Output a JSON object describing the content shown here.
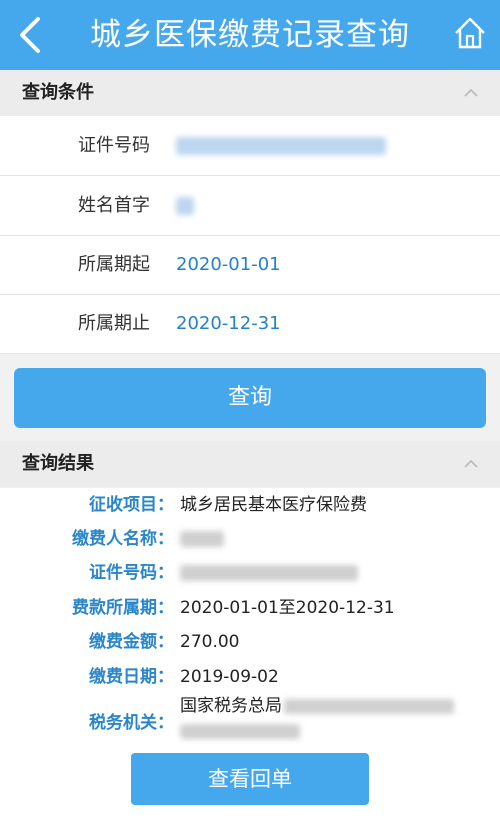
{
  "header": {
    "title": "城乡医保缴费记录查询",
    "back_icon": "chevron-left-icon",
    "home_icon": "home-icon"
  },
  "query_section": {
    "title": "查询条件",
    "fields": [
      {
        "label": "证件号码",
        "value": ""
      },
      {
        "label": "姓名首字",
        "value": ""
      },
      {
        "label": "所属期起",
        "value": "2020-01-01"
      },
      {
        "label": "所属期止",
        "value": "2020-12-31"
      }
    ],
    "submit_label": "查询"
  },
  "result_section": {
    "title": "查询结果",
    "items": [
      {
        "label": "征收项目：",
        "value": "城乡居民基本医疗保险费"
      },
      {
        "label": "缴费人名称：",
        "value": ""
      },
      {
        "label": "证件号码：",
        "value": ""
      },
      {
        "label": "费款所属期：",
        "value": "2020-01-01至2020-12-31"
      },
      {
        "label": "缴费金额：",
        "value": "270.00"
      },
      {
        "label": "缴费日期：",
        "value": "2019-09-02"
      },
      {
        "label": "税务机关：",
        "value": "国家税务总局"
      }
    ],
    "view_label": "查看回单"
  },
  "colors": {
    "primary": "#46a8ec",
    "label_blue": "#2a86c9",
    "value_blue": "#2680c8"
  }
}
